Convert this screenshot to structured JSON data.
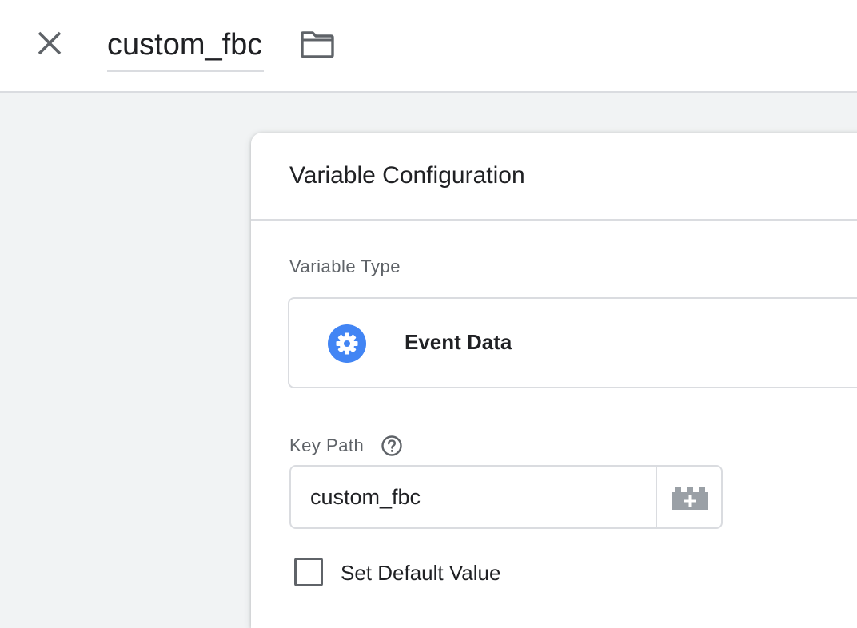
{
  "header": {
    "variable_name": "custom_fbc",
    "close_icon": "close-icon",
    "folder_icon": "folder-icon"
  },
  "card": {
    "title": "Variable Configuration",
    "variable_type_label": "Variable Type",
    "variable_type": {
      "name": "Event Data",
      "icon": "gear-icon",
      "icon_color": "#4285f4"
    },
    "key_path": {
      "label": "Key Path",
      "help_icon": "help-icon",
      "value": "custom_fbc",
      "picker_icon": "variable-picker-icon"
    },
    "default_value": {
      "label": "Set Default Value",
      "checked": false
    }
  }
}
